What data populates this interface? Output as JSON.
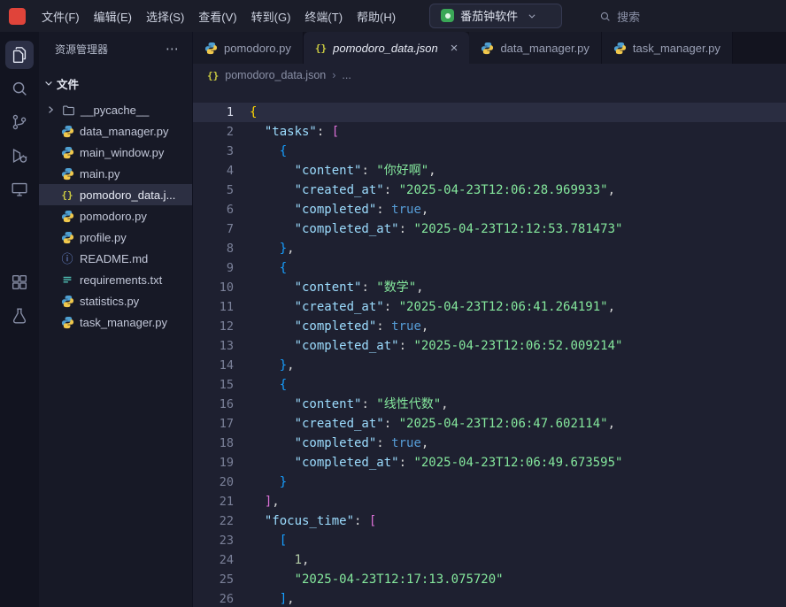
{
  "colors": {
    "accent-red": "#e0443a",
    "app-icon-green": "#3aa757",
    "json-icon-yellow": "#cbcb41",
    "key": "#9cdcfe",
    "string": "#85e89d",
    "keyword": "#569cd6",
    "number": "#b5cea8",
    "punct": "#d4d4d4",
    "bracket1": "#ffd700",
    "bracket2": "#da70d6",
    "bracket3": "#179fff"
  },
  "titlebar": {
    "menus": [
      "文件(F)",
      "编辑(E)",
      "选择(S)",
      "查看(V)",
      "转到(G)",
      "终端(T)",
      "帮助(H)"
    ],
    "app_title": "番茄钟软件",
    "search_label": "搜索"
  },
  "activity_bar": {
    "items": [
      {
        "name": "explorer",
        "active": true,
        "group": 1
      },
      {
        "name": "search",
        "active": false,
        "group": 1
      },
      {
        "name": "source-control",
        "active": false,
        "group": 1
      },
      {
        "name": "run-debug",
        "active": false,
        "group": 1
      },
      {
        "name": "remote",
        "active": false,
        "group": 1
      },
      {
        "name": "extensions",
        "active": false,
        "group": 2
      },
      {
        "name": "testing",
        "active": false,
        "group": 2
      }
    ]
  },
  "sidebar": {
    "title": "资源管理器",
    "section_label": "文件",
    "files": [
      {
        "label": "__pycache__",
        "icon": "folder",
        "kind": "folder",
        "selected": false
      },
      {
        "label": "data_manager.py",
        "icon": "python",
        "selected": false
      },
      {
        "label": "main_window.py",
        "icon": "python",
        "selected": false
      },
      {
        "label": "main.py",
        "icon": "python",
        "selected": false
      },
      {
        "label": "pomodoro_data.j...",
        "icon": "json",
        "selected": true
      },
      {
        "label": "pomodoro.py",
        "icon": "python",
        "selected": false
      },
      {
        "label": "profile.py",
        "icon": "python",
        "selected": false
      },
      {
        "label": "README.md",
        "icon": "info",
        "selected": false
      },
      {
        "label": "requirements.txt",
        "icon": "text",
        "selected": false
      },
      {
        "label": "statistics.py",
        "icon": "python",
        "selected": false
      },
      {
        "label": "task_manager.py",
        "icon": "python",
        "selected": false
      }
    ]
  },
  "editor": {
    "tabs": [
      {
        "label": "pomodoro.py",
        "icon": "python",
        "active": false
      },
      {
        "label": "pomodoro_data.json",
        "icon": "json",
        "active": true
      },
      {
        "label": "data_manager.py",
        "icon": "python",
        "active": false
      },
      {
        "label": "task_manager.py",
        "icon": "python",
        "active": false
      }
    ],
    "breadcrumb": {
      "file": "pomodoro_data.json",
      "more": "..."
    },
    "lines": [
      {
        "n": 1,
        "cur": true,
        "t": [
          [
            "{",
            "b1"
          ]
        ]
      },
      {
        "n": 2,
        "cur": false,
        "t": [
          [
            "  ",
            "pn"
          ],
          [
            "\"tasks\"",
            "k"
          ],
          [
            ": ",
            "pn"
          ],
          [
            "[",
            "b2"
          ]
        ]
      },
      {
        "n": 3,
        "cur": false,
        "t": [
          [
            "    ",
            "pn"
          ],
          [
            "{",
            "b3"
          ]
        ]
      },
      {
        "n": 4,
        "cur": false,
        "t": [
          [
            "      ",
            "pn"
          ],
          [
            "\"content\"",
            "k"
          ],
          [
            ": ",
            "pn"
          ],
          [
            "\"你好啊\"",
            "s"
          ],
          [
            ",",
            "pn"
          ]
        ]
      },
      {
        "n": 5,
        "cur": false,
        "t": [
          [
            "      ",
            "pn"
          ],
          [
            "\"created_at\"",
            "k"
          ],
          [
            ": ",
            "pn"
          ],
          [
            "\"2025-04-23T12:06:28.969933\"",
            "s"
          ],
          [
            ",",
            "pn"
          ]
        ]
      },
      {
        "n": 6,
        "cur": false,
        "t": [
          [
            "      ",
            "pn"
          ],
          [
            "\"completed\"",
            "k"
          ],
          [
            ": ",
            "pn"
          ],
          [
            "true",
            "kw"
          ],
          [
            ",",
            "pn"
          ]
        ]
      },
      {
        "n": 7,
        "cur": false,
        "t": [
          [
            "      ",
            "pn"
          ],
          [
            "\"completed_at\"",
            "k"
          ],
          [
            ": ",
            "pn"
          ],
          [
            "\"2025-04-23T12:12:53.781473\"",
            "s"
          ]
        ]
      },
      {
        "n": 8,
        "cur": false,
        "t": [
          [
            "    ",
            "pn"
          ],
          [
            "}",
            "b3"
          ],
          [
            ",",
            "pn"
          ]
        ]
      },
      {
        "n": 9,
        "cur": false,
        "t": [
          [
            "    ",
            "pn"
          ],
          [
            "{",
            "b3"
          ]
        ]
      },
      {
        "n": 10,
        "cur": false,
        "t": [
          [
            "      ",
            "pn"
          ],
          [
            "\"content\"",
            "k"
          ],
          [
            ": ",
            "pn"
          ],
          [
            "\"数学\"",
            "s"
          ],
          [
            ",",
            "pn"
          ]
        ]
      },
      {
        "n": 11,
        "cur": false,
        "t": [
          [
            "      ",
            "pn"
          ],
          [
            "\"created_at\"",
            "k"
          ],
          [
            ": ",
            "pn"
          ],
          [
            "\"2025-04-23T12:06:41.264191\"",
            "s"
          ],
          [
            ",",
            "pn"
          ]
        ]
      },
      {
        "n": 12,
        "cur": false,
        "t": [
          [
            "      ",
            "pn"
          ],
          [
            "\"completed\"",
            "k"
          ],
          [
            ": ",
            "pn"
          ],
          [
            "true",
            "kw"
          ],
          [
            ",",
            "pn"
          ]
        ]
      },
      {
        "n": 13,
        "cur": false,
        "t": [
          [
            "      ",
            "pn"
          ],
          [
            "\"completed_at\"",
            "k"
          ],
          [
            ": ",
            "pn"
          ],
          [
            "\"2025-04-23T12:06:52.009214\"",
            "s"
          ]
        ]
      },
      {
        "n": 14,
        "cur": false,
        "t": [
          [
            "    ",
            "pn"
          ],
          [
            "}",
            "b3"
          ],
          [
            ",",
            "pn"
          ]
        ]
      },
      {
        "n": 15,
        "cur": false,
        "t": [
          [
            "    ",
            "pn"
          ],
          [
            "{",
            "b3"
          ]
        ]
      },
      {
        "n": 16,
        "cur": false,
        "t": [
          [
            "      ",
            "pn"
          ],
          [
            "\"content\"",
            "k"
          ],
          [
            ": ",
            "pn"
          ],
          [
            "\"线性代数\"",
            "s"
          ],
          [
            ",",
            "pn"
          ]
        ]
      },
      {
        "n": 17,
        "cur": false,
        "t": [
          [
            "      ",
            "pn"
          ],
          [
            "\"created_at\"",
            "k"
          ],
          [
            ": ",
            "pn"
          ],
          [
            "\"2025-04-23T12:06:47.602114\"",
            "s"
          ],
          [
            ",",
            "pn"
          ]
        ]
      },
      {
        "n": 18,
        "cur": false,
        "t": [
          [
            "      ",
            "pn"
          ],
          [
            "\"completed\"",
            "k"
          ],
          [
            ": ",
            "pn"
          ],
          [
            "true",
            "kw"
          ],
          [
            ",",
            "pn"
          ]
        ]
      },
      {
        "n": 19,
        "cur": false,
        "t": [
          [
            "      ",
            "pn"
          ],
          [
            "\"completed_at\"",
            "k"
          ],
          [
            ": ",
            "pn"
          ],
          [
            "\"2025-04-23T12:06:49.673595\"",
            "s"
          ]
        ]
      },
      {
        "n": 20,
        "cur": false,
        "t": [
          [
            "    ",
            "pn"
          ],
          [
            "}",
            "b3"
          ]
        ]
      },
      {
        "n": 21,
        "cur": false,
        "t": [
          [
            "  ",
            "pn"
          ],
          [
            "]",
            "b2"
          ],
          [
            ",",
            "pn"
          ]
        ]
      },
      {
        "n": 22,
        "cur": false,
        "t": [
          [
            "  ",
            "pn"
          ],
          [
            "\"focus_time\"",
            "k"
          ],
          [
            ": ",
            "pn"
          ],
          [
            "[",
            "b2"
          ]
        ]
      },
      {
        "n": 23,
        "cur": false,
        "t": [
          [
            "    ",
            "pn"
          ],
          [
            "[",
            "b3"
          ]
        ]
      },
      {
        "n": 24,
        "cur": false,
        "t": [
          [
            "      ",
            "pn"
          ],
          [
            "1",
            "n"
          ],
          [
            ",",
            "pn"
          ]
        ]
      },
      {
        "n": 25,
        "cur": false,
        "t": [
          [
            "      ",
            "pn"
          ],
          [
            "\"2025-04-23T12:17:13.075720\"",
            "s"
          ]
        ]
      },
      {
        "n": 26,
        "cur": false,
        "t": [
          [
            "    ",
            "pn"
          ],
          [
            "]",
            "b3"
          ],
          [
            ",",
            "pn"
          ]
        ]
      }
    ]
  }
}
